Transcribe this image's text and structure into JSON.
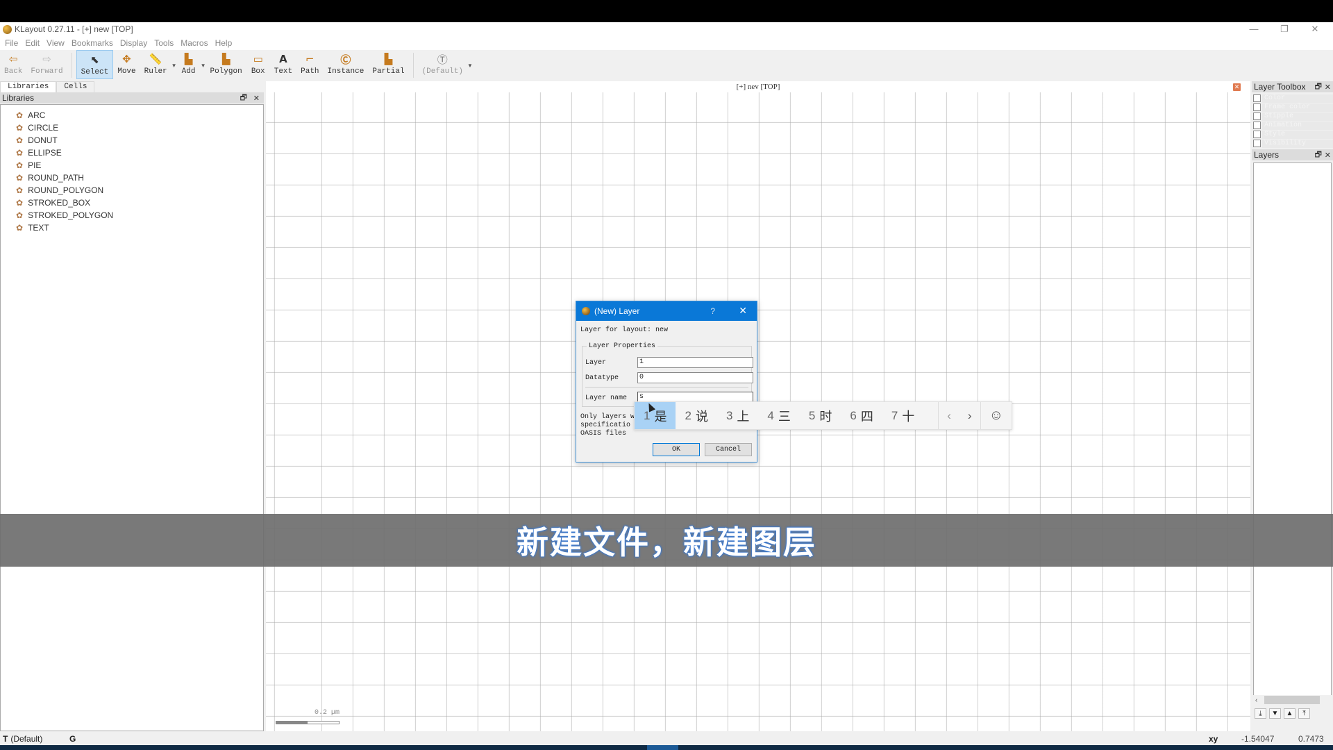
{
  "window": {
    "title": "KLayout 0.27.11 - [+] new [TOP]",
    "controls": {
      "minimize": "—",
      "maximize": "❐",
      "close": "✕"
    }
  },
  "menu": [
    "File",
    "Edit",
    "View",
    "Bookmarks",
    "Display",
    "Tools",
    "Macros",
    "Help"
  ],
  "toolbar": {
    "back": "Back",
    "forward": "Forward",
    "select": "Select",
    "move": "Move",
    "ruler": "Ruler",
    "add": "Add",
    "polygon": "Polygon",
    "box": "Box",
    "text": "Text",
    "path": "Path",
    "instance": "Instance",
    "partial": "Partial",
    "default": "(Default)"
  },
  "left_tabs": [
    "Libraries",
    "Cells"
  ],
  "libraries": {
    "title": "Libraries",
    "items": [
      "ARC",
      "CIRCLE",
      "DONUT",
      "ELLIPSE",
      "PIE",
      "ROUND_PATH",
      "ROUND_POLYGON",
      "STROKED_BOX",
      "STROKED_POLYGON",
      "TEXT"
    ]
  },
  "canvas": {
    "title": "[+] nev [TOP]",
    "scale_label": "0.2 µm"
  },
  "layer_toolbox": {
    "title": "Layer Toolbox",
    "rows": [
      "Color",
      "Frame color",
      "Stipple",
      "Animation",
      "Style",
      "Visibility"
    ]
  },
  "layers_panel": {
    "title": "Layers"
  },
  "dialog": {
    "title": "(New) Layer",
    "help": "?",
    "close": "✕",
    "subtitle": "Layer for layout: new",
    "group_title": "Layer Properties",
    "layer_label": "Layer",
    "layer_value": "1",
    "datatype_label": "Datatype",
    "datatype_value": "0",
    "name_label": "Layer name",
    "name_value": "s",
    "note_lines": [
      "Only layers w",
      "specificatio",
      "OASIS files"
    ],
    "ok": "OK",
    "cancel": "Cancel"
  },
  "ime": {
    "candidates": [
      {
        "num": "1",
        "text": "是"
      },
      {
        "num": "2",
        "text": "说"
      },
      {
        "num": "3",
        "text": "上"
      },
      {
        "num": "4",
        "text": "三"
      },
      {
        "num": "5",
        "text": "时"
      },
      {
        "num": "6",
        "text": "四"
      },
      {
        "num": "7",
        "text": "十"
      }
    ],
    "prev": "‹",
    "next": "›",
    "emoji": "☺"
  },
  "subtitle": "新建文件，新建图层",
  "statusbar": {
    "mode": "(Default)",
    "mode_icon": "T",
    "grid": "G",
    "coord_label": "xy",
    "x": "-1.54047",
    "y": "0.7473"
  }
}
